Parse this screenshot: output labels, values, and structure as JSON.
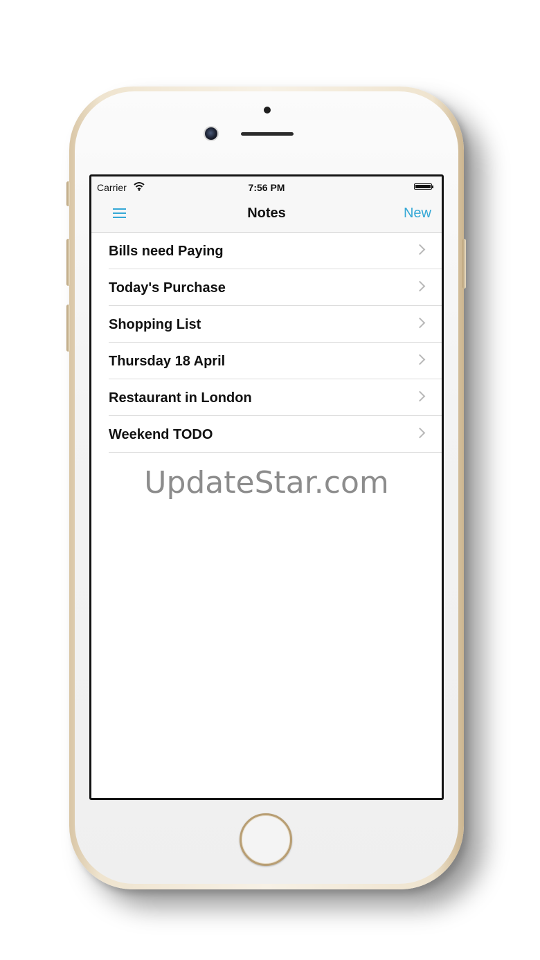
{
  "status_bar": {
    "carrier": "Carrier",
    "time": "7:56 PM",
    "battery_level": 1.0
  },
  "nav": {
    "menu_icon": "hamburger-icon",
    "title": "Notes",
    "new_label": "New"
  },
  "notes": [
    {
      "title": "Bills need Paying"
    },
    {
      "title": "Today's Purchase"
    },
    {
      "title": "Shopping List"
    },
    {
      "title": "Thursday 18 April"
    },
    {
      "title": "Restaurant in London"
    },
    {
      "title": "Weekend TODO"
    }
  ],
  "watermark": "UpdateStar.com",
  "colors": {
    "accent": "#35a8d6",
    "text": "#111111",
    "watermark": "#8c8c8c"
  }
}
